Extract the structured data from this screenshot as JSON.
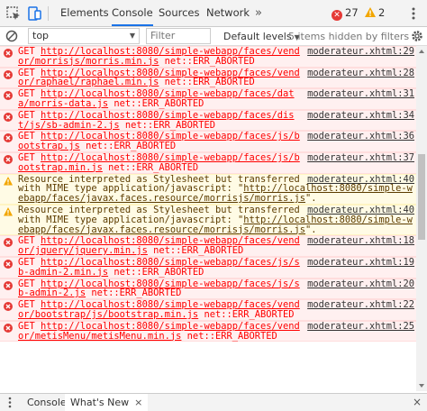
{
  "devtools": {
    "tabs": [
      {
        "label": "Elements",
        "active": false
      },
      {
        "label": "Console",
        "active": true
      },
      {
        "label": "Sources",
        "active": false
      },
      {
        "label": "Network",
        "active": false
      }
    ],
    "more_tabs": "»",
    "error_count": "27",
    "warning_count": "2",
    "accent_color": "#1a73e8",
    "error_color": "#ff0000"
  },
  "toolbar": {
    "context": "top",
    "filter_placeholder": "Filter",
    "levels_label": "Default levels",
    "hidden_note": "5 items hidden by filters"
  },
  "messages": [
    {
      "type": "error",
      "source": "moderateur.xhtml:29",
      "prefix": "GET ",
      "url": "http://localhost:8080/simple-webapp/faces/vendor/morrisjs/morris.min.js",
      "suffix": " net::ERR_ABORTED"
    },
    {
      "type": "error",
      "source": "moderateur.xhtml:28",
      "prefix": "GET ",
      "url": "http://localhost:8080/simple-webapp/faces/vendor/raphael/raphael.min.js",
      "suffix": " net::ERR_ABORTED"
    },
    {
      "type": "error",
      "source": "moderateur.xhtml:31",
      "prefix": "GET ",
      "url": "http://localhost:8080/simple-webapp/faces/data/morris-data.js",
      "suffix": " net::ERR_ABORTED"
    },
    {
      "type": "error",
      "source": "moderateur.xhtml:34",
      "prefix": "GET ",
      "url": "http://localhost:8080/simple-webapp/faces/dist/js/sb-admin-2.js",
      "suffix": " net::ERR_ABORTED"
    },
    {
      "type": "error",
      "source": "moderateur.xhtml:36",
      "prefix": "GET ",
      "url": "http://localhost:8080/simple-webapp/faces/js/bootstrap.js",
      "suffix": " net::ERR_ABORTED"
    },
    {
      "type": "error",
      "source": "moderateur.xhtml:37",
      "prefix": "GET ",
      "url": "http://localhost:8080/simple-webapp/faces/js/bootstrap.min.js",
      "suffix": " net::ERR_ABORTED"
    },
    {
      "type": "warning",
      "source": "moderateur.xhtml:40",
      "prefix": "Resource interpreted as Stylesheet but transferred with MIME type application/javascript: \"",
      "url": "http://localhost:8080/simple-webapp/faces/javax.faces.resource/morrisjs/morris.js",
      "suffix": "\"."
    },
    {
      "type": "warning",
      "source": "moderateur.xhtml:40",
      "prefix": "Resource interpreted as Stylesheet but transferred with MIME type application/javascript: \"",
      "url": "http://localhost:8080/simple-webapp/faces/javax.faces.resource/morrisjs/morris.js",
      "suffix": "\"."
    },
    {
      "type": "error",
      "source": "moderateur.xhtml:18",
      "prefix": "GET ",
      "url": "http://localhost:8080/simple-webapp/faces/vendor/jquery/jquery.min.js",
      "suffix": " net::ERR_ABORTED"
    },
    {
      "type": "error",
      "source": "moderateur.xhtml:19",
      "prefix": "GET ",
      "url": "http://localhost:8080/simple-webapp/faces/js/sb-admin-2.min.js",
      "suffix": " net::ERR_ABORTED"
    },
    {
      "type": "error",
      "source": "moderateur.xhtml:20",
      "prefix": "GET ",
      "url": "http://localhost:8080/simple-webapp/faces/js/sb-admin-2.js",
      "suffix": " net::ERR_ABORTED"
    },
    {
      "type": "error",
      "source": "moderateur.xhtml:22",
      "prefix": "GET ",
      "url": "http://localhost:8080/simple-webapp/faces/vendor/bootstrap/js/bootstrap.min.js",
      "suffix": " net::ERR_ABORTED"
    },
    {
      "type": "error",
      "source": "moderateur.xhtml:25",
      "prefix": "GET ",
      "url": "http://localhost:8080/simple-webapp/faces/vendor/metisMenu/metisMenu.min.js",
      "suffix": " net::ERR_ABORTED"
    }
  ],
  "drawer": {
    "tabs": [
      {
        "label": "Console",
        "active": false
      },
      {
        "label": "What's New",
        "active": true
      }
    ],
    "close_glyph": "×"
  }
}
